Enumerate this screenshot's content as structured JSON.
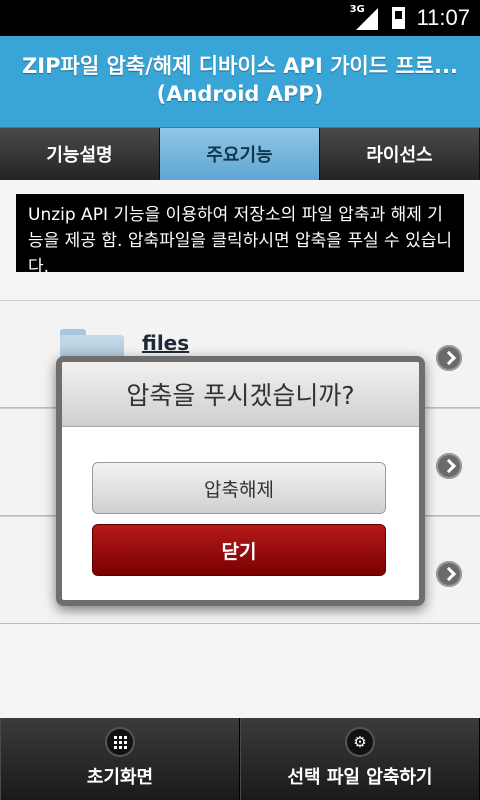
{
  "status_bar": {
    "network": "3G",
    "time": "11:07"
  },
  "header": {
    "title": "ZIP파일 압축/해제 디바이스 API 가이드 프로...",
    "subtitle": "(Android APP)"
  },
  "tabs": [
    {
      "label": "기능설명",
      "active": false
    },
    {
      "label": "주요기능",
      "active": true
    },
    {
      "label": "라이선스",
      "active": false
    }
  ],
  "description": "Unzip API 기능을 이용하여 저장소의 파일 압축과 해제 기능을 제공 함. 압축파일을 클릭하시면 압축을 푸실 수 있습니다.",
  "file_list": [
    {
      "name": "files"
    },
    {
      "name": ""
    },
    {
      "name": ""
    }
  ],
  "dialog": {
    "title": "압축을 푸시겠습니까?",
    "unzip_label": "압축해제",
    "close_label": "닫기"
  },
  "bottom_bar": {
    "home_label": "초기화면",
    "compress_label": "선택 파일 압축하기"
  },
  "icons": {
    "home": "grid-icon",
    "compress": "gear-icon",
    "list_arrow": "chevron-right-icon"
  },
  "colors": {
    "header_bg": "#38a5d6",
    "active_tab": "#6fb3db",
    "close_button": "#9c0b0b"
  }
}
